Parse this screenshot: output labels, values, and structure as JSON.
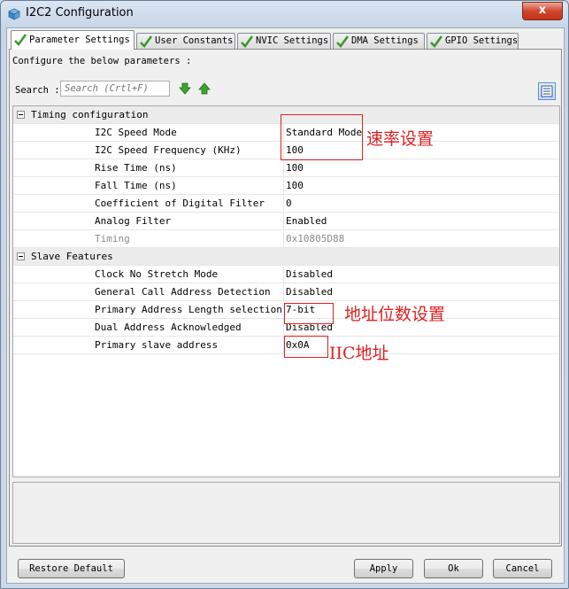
{
  "window": {
    "title": "I2C2 Configuration",
    "close_label": "x"
  },
  "tabs": [
    {
      "label": "Parameter Settings",
      "active": true
    },
    {
      "label": "User Constants",
      "active": false
    },
    {
      "label": "NVIC Settings",
      "active": false
    },
    {
      "label": "DMA Settings",
      "active": false
    },
    {
      "label": "GPIO Settings",
      "active": false
    }
  ],
  "panel": {
    "configure_label": "Configure the below parameters :",
    "search_label": "Search :",
    "search_placeholder": "Search (Crtl+F)"
  },
  "grid": {
    "categories": [
      {
        "label": "Timing configuration",
        "properties": [
          {
            "name": "I2C Speed Mode",
            "value": "Standard Mode"
          },
          {
            "name": "I2C Speed Frequency (KHz)",
            "value": "100"
          },
          {
            "name": "Rise Time (ns)",
            "value": "100"
          },
          {
            "name": "Fall Time (ns)",
            "value": "100"
          },
          {
            "name": "Coefficient of Digital Filter",
            "value": "0"
          },
          {
            "name": "Analog Filter",
            "value": "Enabled"
          },
          {
            "name": "Timing",
            "value": "0x10805D88",
            "readonly": true
          }
        ]
      },
      {
        "label": "Slave Features",
        "properties": [
          {
            "name": "Clock No Stretch Mode",
            "value": "Disabled"
          },
          {
            "name": "General Call Address Detection",
            "value": "Disabled"
          },
          {
            "name": "Primary Address Length selection",
            "value": "7-bit"
          },
          {
            "name": "Dual Address Acknowledged",
            "value": "Disabled"
          },
          {
            "name": "Primary slave address",
            "value": "0x0A"
          }
        ]
      }
    ]
  },
  "buttons": {
    "restore_default": "Restore Default",
    "apply": "Apply",
    "ok": "Ok",
    "cancel": "Cancel"
  },
  "annotations": {
    "speed": "速率设置",
    "address_length": "地址位数设置",
    "iic_address": "IIC地址"
  },
  "colors": {
    "annotation": "#e02020",
    "check": "#3a9a2a",
    "arrow": "#3aa62a"
  }
}
